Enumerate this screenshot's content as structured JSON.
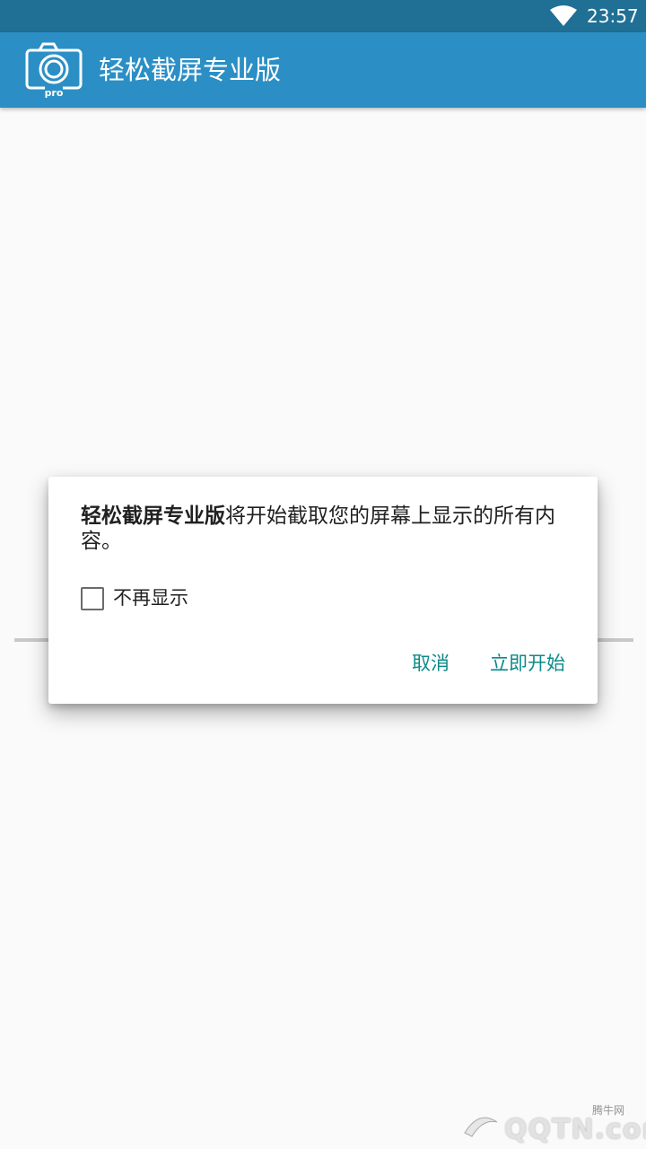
{
  "status_bar": {
    "time": "23:57",
    "icons": [
      "wifi-icon"
    ]
  },
  "app_bar": {
    "logo": "camera-pro-icon",
    "logo_badge": "pro",
    "title": "轻松截屏专业版"
  },
  "dialog": {
    "app_name": "轻松截屏专业版",
    "message": "将开始截取您的屏幕上显示的所有内容。",
    "checkbox_label": "不再显示",
    "checkbox_checked": false,
    "cancel_label": "取消",
    "confirm_label": "立即开始"
  },
  "watermark": {
    "site": "腾牛网",
    "text": "QQTN.com"
  },
  "colors": {
    "status_bar": "#206f95",
    "app_bar": "#2b8fc5",
    "accent": "#0d8a8a",
    "background": "#fafafa"
  }
}
